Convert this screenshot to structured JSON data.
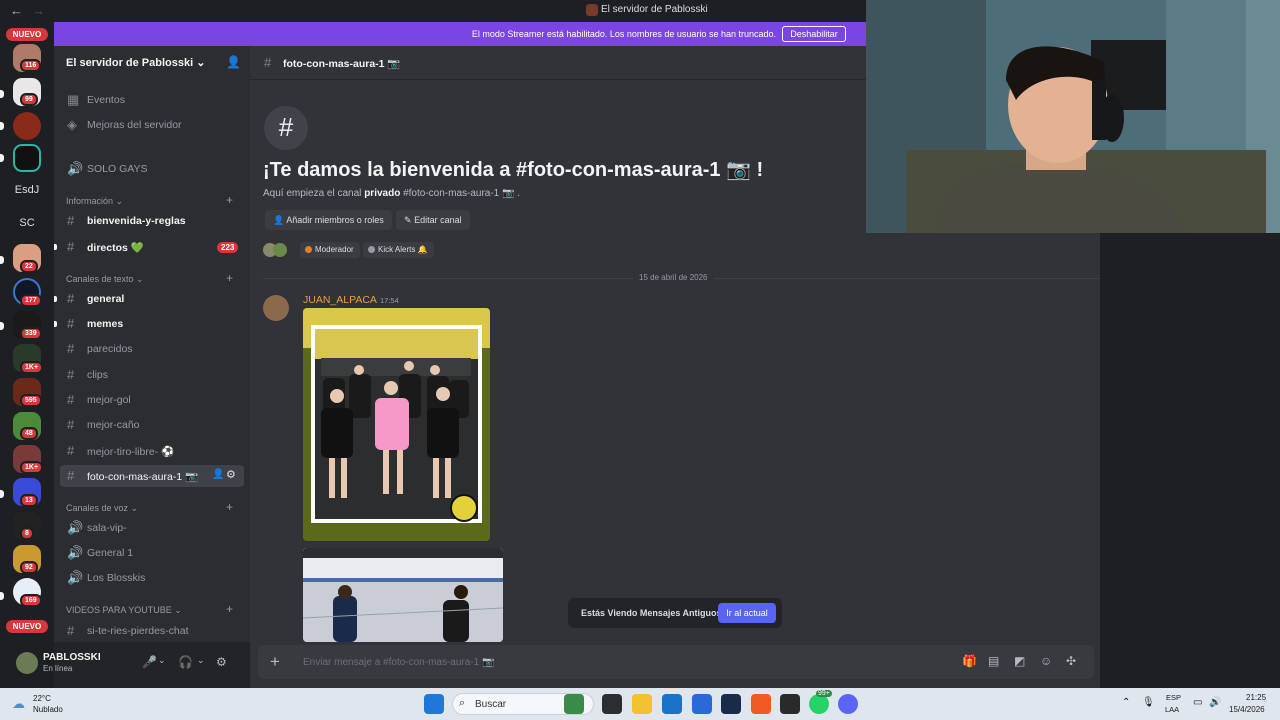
{
  "window": {
    "title": "El servidor de Pablosski"
  },
  "streamer_banner": {
    "message": "El modo Streamer está habilitado. Los nombres de usuario se han truncado.",
    "button": "Deshabilitar"
  },
  "rail": {
    "new_top": "NUEVO",
    "new_bottom": "NUEVO",
    "esdj": "EsdJ",
    "sc": "SC",
    "badges": [
      "116",
      "99",
      "22",
      "177",
      "339",
      "1K+",
      "595",
      "48",
      "1K+",
      "13",
      "8",
      "92",
      "169"
    ]
  },
  "server": {
    "name": "El servidor de Pablosski",
    "events": "Eventos",
    "boosts": "Mejoras del servidor",
    "voice_top": "SOLO GAYS",
    "cat_info": "Información",
    "info_channels": [
      "bienvenida-y-reglas",
      "directos 💚"
    ],
    "directos_count": "223",
    "cat_text": "Canales de texto",
    "text_channels": [
      "general",
      "memes",
      "parecidos",
      "clips",
      "mejor-gol",
      "mejor-caño",
      "mejor-tiro-libre- ⚽",
      "foto-con-mas-aura-1 📷"
    ],
    "cat_voice": "Canales de voz",
    "voice_channels": [
      "sala-vip-",
      "General 1",
      "Los Blosskis"
    ],
    "cat_youtube": "VIDEOS PARA YOUTUBE",
    "youtube_channels": [
      "si-te-ries-pierdes-chat"
    ]
  },
  "user": {
    "name": "PABLOSSKI",
    "status": "En línea"
  },
  "channel": {
    "name": "foto-con-mas-aura-1 📷",
    "welcome_title": "¡Te damos la bienvenida a #foto-con-mas-aura-1 📷 !",
    "welcome_pre": "Aquí empieza el canal",
    "welcome_bold": "privado",
    "welcome_post": "#foto-con-mas-aura-1 📷 .",
    "add_members": "Añadir miembros o roles",
    "edit_channel": "Editar canal",
    "roles": [
      "Moderador",
      "Kick Alerts 🔔"
    ],
    "date_divider": "15 de abril de 2026"
  },
  "message": {
    "author": "JUAN_ALPACA",
    "time": "17:54"
  },
  "old_messages": {
    "text": "Estás Viendo Mensajes Antiguos",
    "button": "Ir al actual"
  },
  "composer": {
    "placeholder": "Enviar mensaje a #foto-con-mas-aura-1 📷"
  },
  "taskbar": {
    "temp": "22°C",
    "weather": "Nublado",
    "search": "Buscar",
    "lang": "ESP",
    "layout": "LAA",
    "time": "21:25",
    "date": "15/4/2026",
    "whatsapp_badge": "99+"
  },
  "colors": {
    "accent": "#5865f2",
    "streamer": "#7a45e2",
    "author": "#e7a33b",
    "badge": "#da373c"
  }
}
